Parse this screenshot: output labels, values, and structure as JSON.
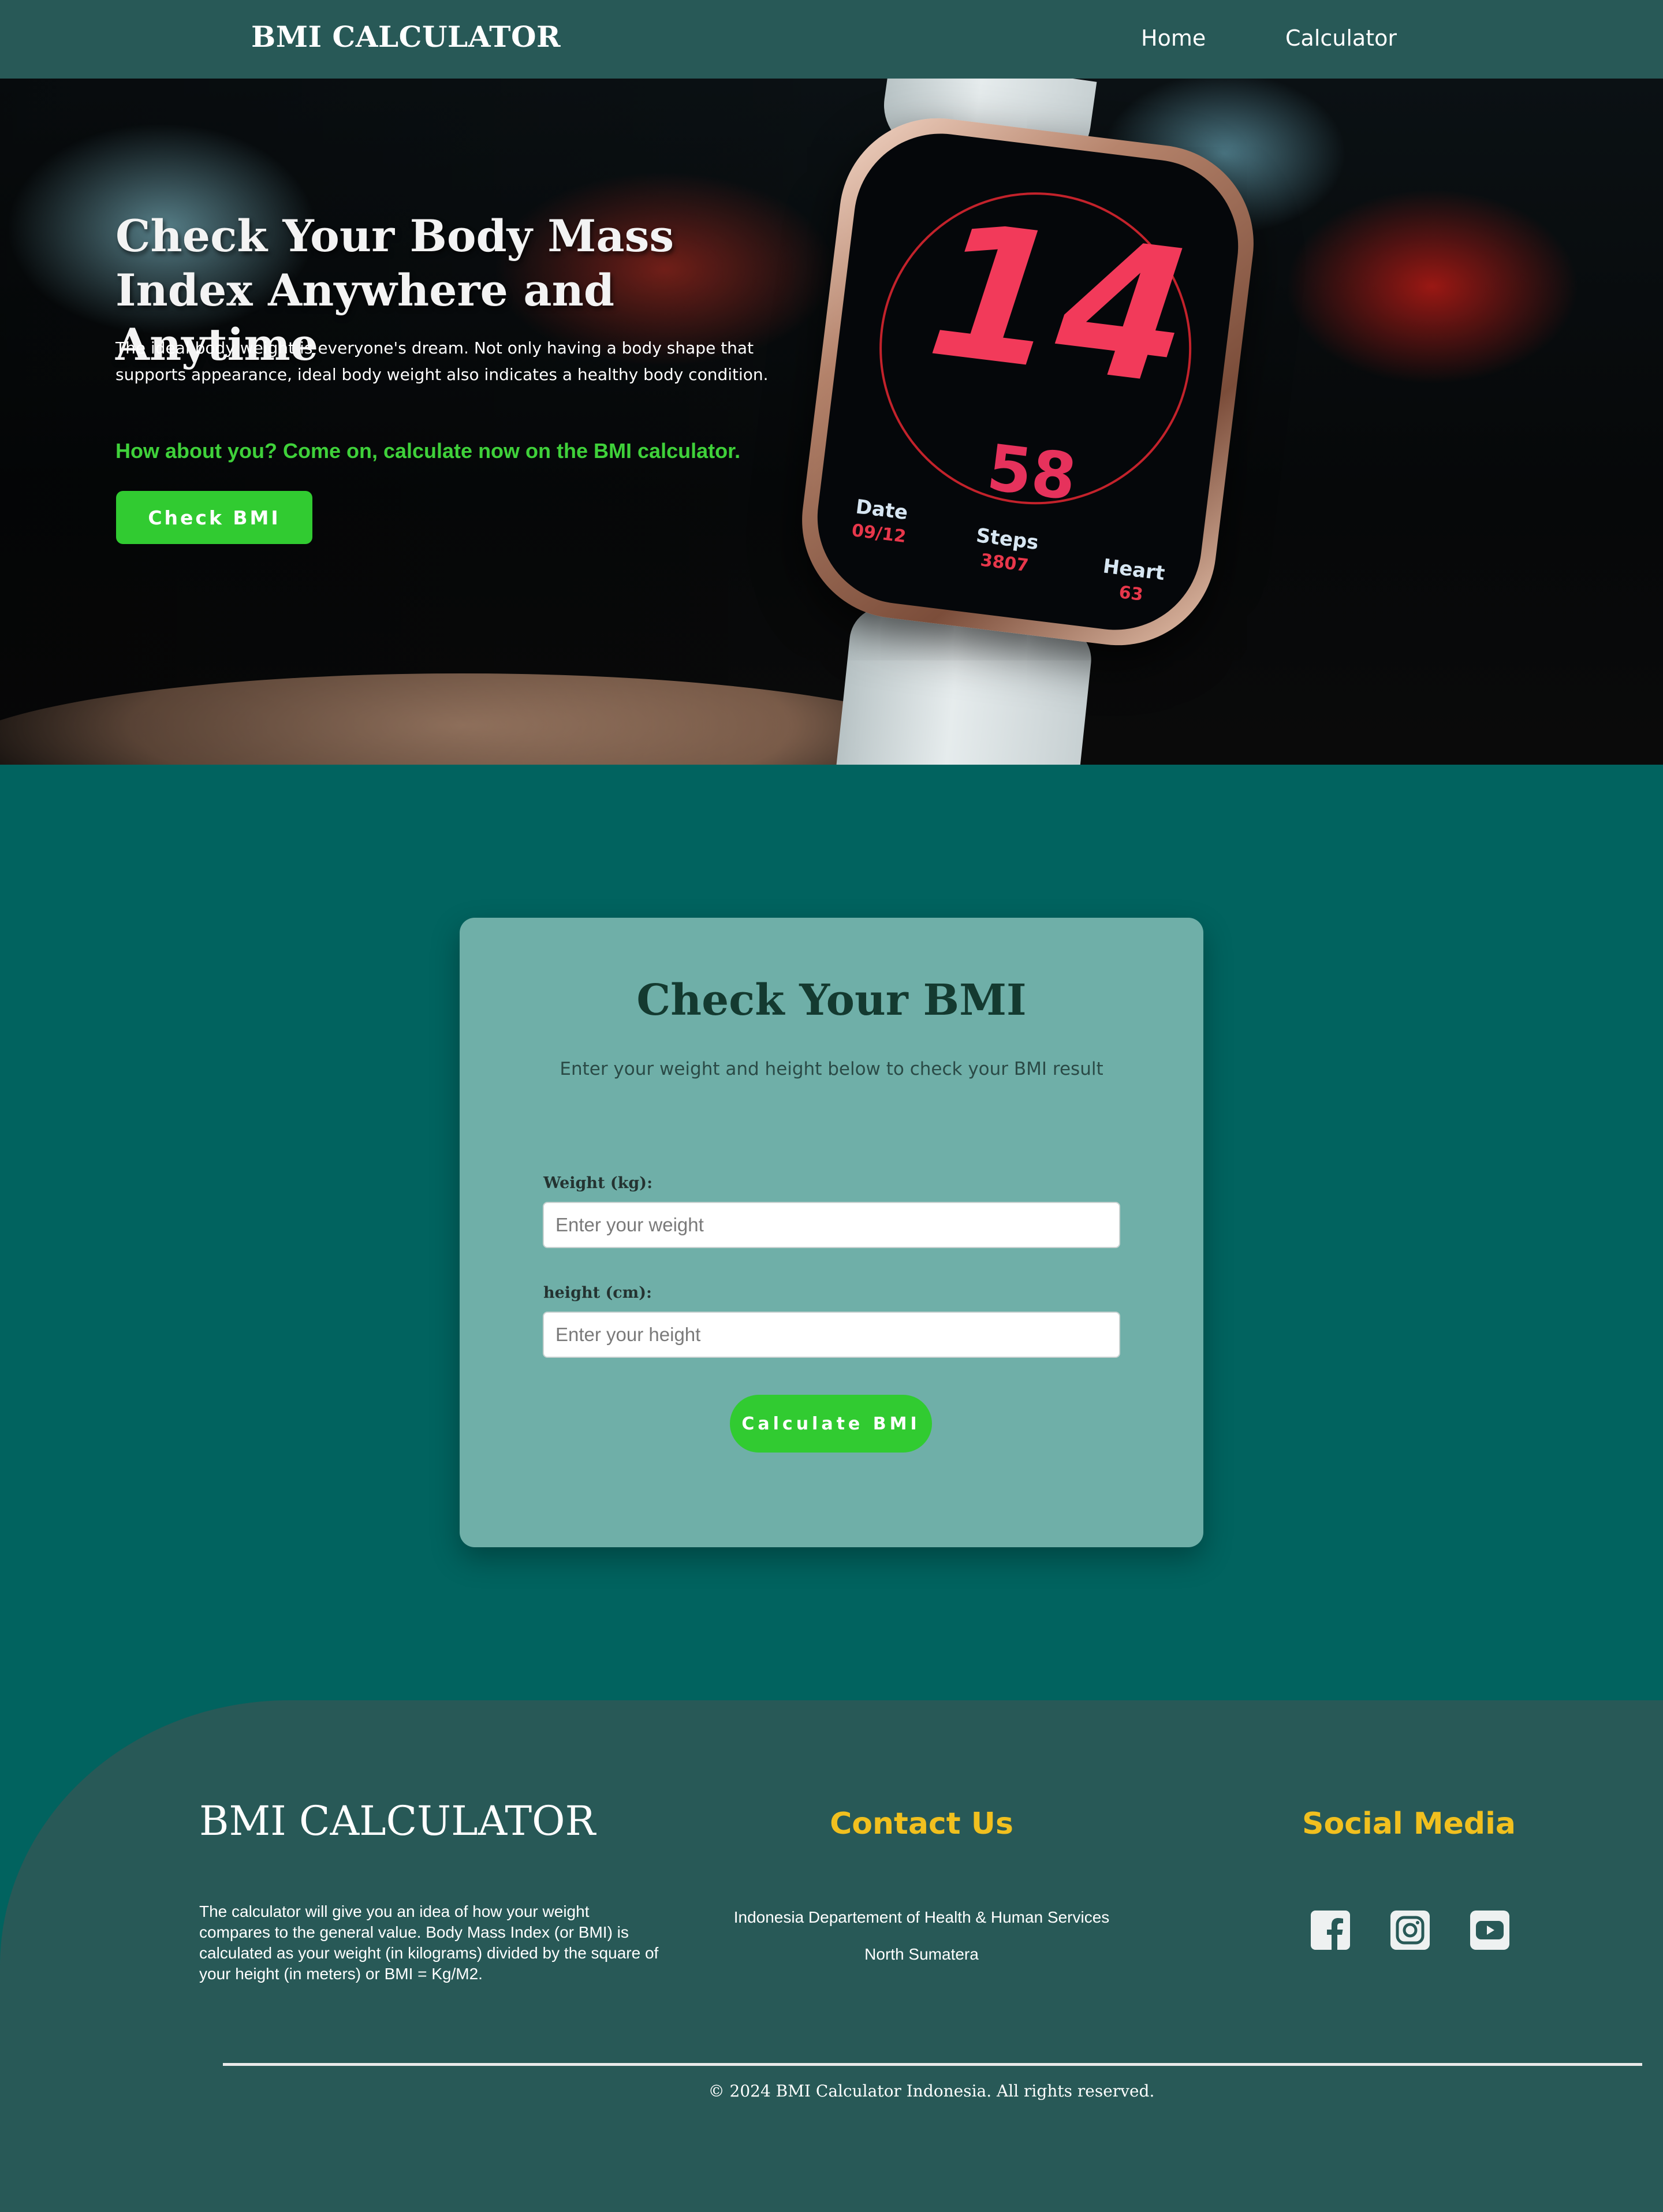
{
  "navbar": {
    "brand": "BMI CALCULATOR",
    "links": [
      {
        "label": "Home"
      },
      {
        "label": "Calculator"
      }
    ]
  },
  "hero": {
    "title": "Check Your Body Mass Index Anywhere and Anytime",
    "text": "The ideal body weight is everyone's dream. Not only having a body shape that supports appearance, ideal body weight also indicates a healthy body condition.",
    "cta_text": "How about you? Come on, calculate now on the BMI calculator.",
    "button_label": "Check BMI",
    "watch": {
      "hour": "14",
      "minute": "58",
      "date_label": "Date",
      "date_value": "09/12",
      "steps_label": "Steps",
      "steps_value": "3807",
      "heart_label": "Heart",
      "heart_value": "63"
    }
  },
  "calculator": {
    "title": "Check Your BMI",
    "subtitle": "Enter your weight and height below to check your BMI result",
    "weight_label": "Weight (kg):",
    "weight_placeholder": "Enter your weight",
    "weight_value": "",
    "height_label": "height (cm):",
    "height_placeholder": "Enter your height",
    "height_value": "",
    "button_label": "Calculate BMI"
  },
  "footer": {
    "brand": "BMI CALCULATOR",
    "description": "The calculator will give you an idea of how your weight compares to the general value. Body Mass Index (or BMI) is calculated as your weight (in kilograms) divided by the square of your height (in meters) or BMI = Kg/M2.",
    "contact_heading": "Contact Us",
    "contact_lines": [
      "Indonesia Departement of Health & Human Services",
      "North Sumatera"
    ],
    "social_heading": "Social Media",
    "social_icons": [
      "facebook-icon",
      "instagram-icon",
      "youtube-icon"
    ],
    "copyright": "© 2024 BMI Calculator Indonesia. All rights reserved."
  },
  "colors": {
    "nav_bg": "#285957",
    "page_bg": "#01635f",
    "card_bg": "#6fafa8",
    "accent_green": "#31cb31",
    "footer_heading": "#f1c01f"
  }
}
